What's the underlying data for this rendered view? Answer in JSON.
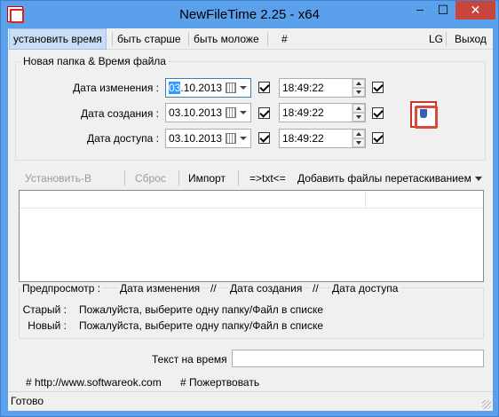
{
  "window": {
    "title": "NewFileTime 2.25 - x64"
  },
  "titlebar": {
    "minimize": "–",
    "maximize": "☐",
    "close": "✕"
  },
  "menu": {
    "items": [
      "установить время",
      "быть старше",
      "быть моложе",
      "#"
    ],
    "right_items": [
      "LG",
      "Выход"
    ]
  },
  "file_time_group": {
    "title": "Новая папка & Время файла",
    "rows": [
      {
        "label": "Дата изменения :",
        "date": "03.10.2013",
        "date_selected": "03",
        "date_rest": ".10.2013",
        "time": "18:49:22",
        "date_checked": true,
        "time_checked": true
      },
      {
        "label": "Дата создания :",
        "date": "03.10.2013",
        "time": "18:49:22",
        "date_checked": true,
        "time_checked": true
      },
      {
        "label": "Дата доступа :",
        "date": "03.10.2013",
        "time": "18:49:22",
        "date_checked": true,
        "time_checked": true
      }
    ]
  },
  "toolbar": {
    "set": "Установить-В",
    "reset": "Сброс",
    "import": "Импорт",
    "txt": "=>txt<=",
    "add_files": "Добавить файлы перетаскиванием"
  },
  "preview": {
    "label": "Предпросмотр :",
    "cols": [
      "Дата изменения",
      "//",
      "Дата создания",
      "//",
      "Дата доступа"
    ],
    "old_label": "Старый :",
    "old_value": "Пожалуйста, выберите одну папку/Файл в списке",
    "new_label": "Новый :",
    "new_value": "Пожалуйста, выберите одну папку/Файл в списке"
  },
  "text_time": {
    "label": "Текст на время",
    "value": ""
  },
  "links": {
    "website": "# http://www.softwareok.com",
    "donate": "# Пожертвовать"
  },
  "status": {
    "text": "Готово"
  }
}
